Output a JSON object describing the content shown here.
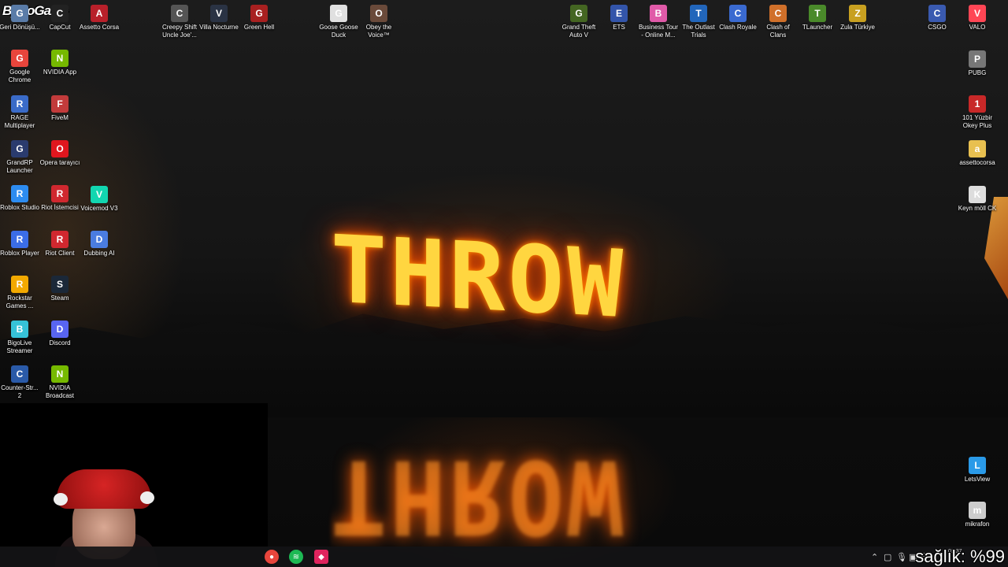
{
  "watermark": "ByNoGame",
  "wallpaper": {
    "headline": "THROW",
    "accent": "#ffb020"
  },
  "desktop_icons": {
    "col1": [
      {
        "label": "Geri Dönüşü...",
        "icon": "recycle-bin",
        "color": "#5a7ca8"
      },
      {
        "label": "Google Chrome",
        "icon": "chrome",
        "color": "#e8453c"
      },
      {
        "label": "RAGE Multiplayer",
        "icon": "rage-mp",
        "color": "#3a6bc8"
      },
      {
        "label": "GrandRP Launcher",
        "icon": "grandrp",
        "color": "#2a3b6e"
      },
      {
        "label": "Roblox Studio",
        "icon": "roblox-studio",
        "color": "#2d8cf0"
      },
      {
        "label": "Roblox Player",
        "icon": "roblox",
        "color": "#3b6de6"
      },
      {
        "label": "Rockstar Games ...",
        "icon": "rockstar",
        "color": "#f2a900"
      },
      {
        "label": "BigoLive Streamer",
        "icon": "bigolive",
        "color": "#36c2d8"
      },
      {
        "label": "Counter-Str... 2",
        "icon": "cs2",
        "color": "#2a5aa8"
      }
    ],
    "col2": [
      {
        "label": "CapCut",
        "icon": "capcut",
        "color": "#222222"
      },
      {
        "label": "NVIDIA App",
        "icon": "nvidia",
        "color": "#76b900"
      },
      {
        "label": "FiveM",
        "icon": "fivem",
        "color": "#c23b3b"
      },
      {
        "label": "Opera tarayıcı",
        "icon": "opera",
        "color": "#e0161e"
      },
      {
        "label": "Riot İstemcisi",
        "icon": "riot",
        "color": "#d0282f"
      },
      {
        "label": "Riot Client",
        "icon": "riot",
        "color": "#d0282f"
      },
      {
        "label": "Steam",
        "icon": "steam",
        "color": "#1b2838"
      },
      {
        "label": "Discord",
        "icon": "discord",
        "color": "#5865f2"
      },
      {
        "label": "NVIDIA Broadcast",
        "icon": "nvidia-broadcast",
        "color": "#76b900"
      }
    ],
    "col3": [
      {
        "label": "Assetto Corsa",
        "icon": "assetto-corsa",
        "color": "#b8202a"
      },
      {
        "label": "Voicemod V3",
        "icon": "voicemod",
        "color": "#12d6b0"
      },
      {
        "label": "Dubbing AI",
        "icon": "dubbing-ai",
        "color": "#4a7ce0"
      }
    ],
    "top": [
      {
        "label": "Creepy Shift Uncle Joe'...",
        "icon": "creepy-shift",
        "color": "#555555"
      },
      {
        "label": "Villa Nocturne",
        "icon": "villa-nocturne",
        "color": "#2a3344"
      },
      {
        "label": "Green Hell",
        "icon": "green-hell",
        "color": "#a82020"
      },
      {
        "label": "Goose Goose Duck",
        "icon": "goose-goose-duck",
        "color": "#e0e0e0"
      },
      {
        "label": "Obey the Voice™",
        "icon": "obey-the-voice",
        "color": "#6a4a3a"
      },
      {
        "label": "Grand Theft Auto V",
        "icon": "gta-v",
        "color": "#446622"
      },
      {
        "label": "ETS",
        "icon": "ets",
        "color": "#3355aa"
      },
      {
        "label": "Business Tour - Online M...",
        "icon": "business-tour",
        "color": "#e05aa8"
      },
      {
        "label": "The Outlast Trials",
        "icon": "outlast-trials",
        "color": "#2266bb"
      },
      {
        "label": "Clash Royale",
        "icon": "clash-royale",
        "color": "#3a6ad0"
      },
      {
        "label": "Clash of Clans",
        "icon": "clash-of-clans",
        "color": "#d0702a"
      },
      {
        "label": "TLauncher",
        "icon": "tlauncher",
        "color": "#4a8a2a"
      },
      {
        "label": "Zula Türkiye",
        "icon": "zula",
        "color": "#c8a020"
      },
      {
        "label": "CSGO",
        "icon": "csgo",
        "color": "#3a5ab0"
      },
      {
        "label": "VALO",
        "icon": "valorant",
        "color": "#ff4655"
      }
    ],
    "right": [
      {
        "label": "PUBG",
        "icon": "pubg",
        "color": "#777777"
      },
      {
        "label": "101 Yüzbir Okey Plus",
        "icon": "okey-plus",
        "color": "#c82828"
      },
      {
        "label": "assettocorsa",
        "icon": "folder",
        "color": "#e8c050"
      },
      {
        "label": "Keyn möll CK",
        "icon": "media-file",
        "color": "#dddddd"
      },
      {
        "label": "LetsView",
        "icon": "letsview",
        "color": "#2a9ae8"
      },
      {
        "label": "mikrafon",
        "icon": "audio-file",
        "color": "#cccccc"
      }
    ]
  },
  "taskbar": {
    "pinned": [
      {
        "name": "chrome",
        "color": "#e8453c"
      },
      {
        "name": "spotify",
        "color": "#1db954"
      },
      {
        "name": "app",
        "color": "#e0245e"
      }
    ],
    "clock": {
      "time": "01:37",
      "date": ""
    }
  },
  "overlay": {
    "health_text": "sağlık: %99"
  }
}
